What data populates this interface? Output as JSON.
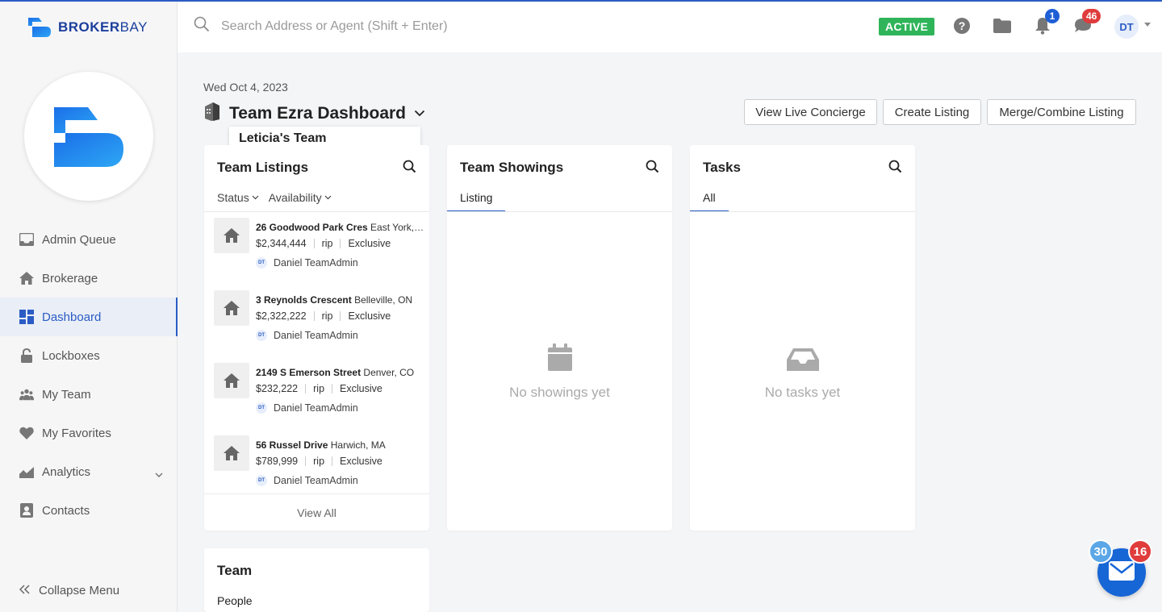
{
  "brand": {
    "name_part1": "BROKER",
    "name_part2": "BAY"
  },
  "search": {
    "placeholder": "Search Address or Agent (Shift + Enter)"
  },
  "header": {
    "status_badge": "ACTIVE",
    "notifications_count": "1",
    "messages_count": "46",
    "avatar_initials": "DT"
  },
  "sidebar": {
    "items": [
      {
        "label": "Admin Queue",
        "icon": "inbox-icon"
      },
      {
        "label": "Brokerage",
        "icon": "home-icon"
      },
      {
        "label": "Dashboard",
        "icon": "dashboard-icon"
      },
      {
        "label": "Lockboxes",
        "icon": "lock-icon"
      },
      {
        "label": "My Team",
        "icon": "team-icon"
      },
      {
        "label": "My Favorites",
        "icon": "heart-icon"
      },
      {
        "label": "Analytics",
        "icon": "analytics-icon"
      },
      {
        "label": "Contacts",
        "icon": "contacts-icon"
      }
    ],
    "active_item": "Dashboard",
    "collapse_label": "Collapse Menu"
  },
  "main": {
    "date": "Wed Oct 4, 2023",
    "title": "Team Ezra Dashboard",
    "team_dropdown_option": "Leticia's Team",
    "buttons": {
      "concierge": "View Live Concierge",
      "create": "Create Listing",
      "merge": "Merge/Combine Listing"
    }
  },
  "listings_card": {
    "title": "Team Listings",
    "filter_status": "Status",
    "filter_availability": "Availability",
    "items": [
      {
        "street": "26 Goodwood Park Cres",
        "city": "East York, ON",
        "price": "$2,344,444",
        "type": "rip",
        "status": "Exclusive",
        "agent": "Daniel TeamAdmin",
        "agent_initials": "DT"
      },
      {
        "street": "3 Reynolds Crescent",
        "city": "Belleville, ON",
        "price": "$2,322,222",
        "type": "rip",
        "status": "Exclusive",
        "agent": "Daniel TeamAdmin",
        "agent_initials": "DT"
      },
      {
        "street": "2149 S Emerson Street",
        "city": "Denver, CO",
        "price": "$232,222",
        "type": "rip",
        "status": "Exclusive",
        "agent": "Daniel TeamAdmin",
        "agent_initials": "DT"
      },
      {
        "street": "56 Russel Drive",
        "city": "Harwich, MA",
        "price": "$789,999",
        "type": "rip",
        "status": "Exclusive",
        "agent": "Daniel TeamAdmin",
        "agent_initials": "DT"
      }
    ],
    "view_all": "View All"
  },
  "showings_card": {
    "title": "Team Showings",
    "tab": "Listing",
    "empty": "No showings yet"
  },
  "tasks_card": {
    "title": "Tasks",
    "tab": "All",
    "empty": "No tasks yet"
  },
  "team_card": {
    "title": "Team",
    "subtitle": "People"
  },
  "chat_widget": {
    "count_left": "30",
    "count_right": "16"
  },
  "colors": {
    "accent": "#2b5cc4",
    "active_badge": "#2fb45a",
    "alert": "#e03c3c",
    "notif": "#1f5fd6"
  }
}
